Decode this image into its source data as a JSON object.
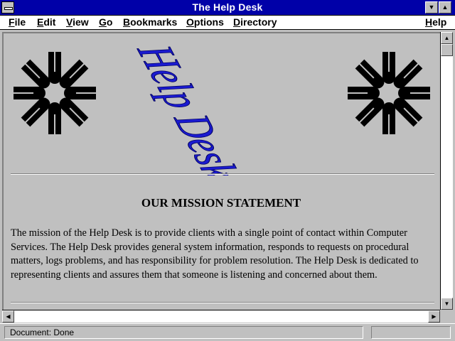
{
  "window": {
    "title": "The Help Desk",
    "minimize_glyph": "▼",
    "maximize_glyph": "▲"
  },
  "menubar": {
    "items": [
      "File",
      "Edit",
      "View",
      "Go",
      "Bookmarks",
      "Options",
      "Directory"
    ],
    "help": "Help"
  },
  "content": {
    "logo_wordart": "Help Desk",
    "wordart_color": "#1a1ad0",
    "logo_icon": "ring-emblem-icon",
    "mission_heading": "OUR MISSION STATEMENT",
    "mission_body": "The mission of the Help Desk is to provide clients with a single point of contact within Computer Services. The Help Desk provides general system information, responds to requests on procedural matters, logs problems, and has responsibility for problem resolution. The Help Desk is dedicated to representing clients and assures them that someone is listening and concerned about them."
  },
  "scrollbars": {
    "up": "▲",
    "down": "▼",
    "left": "◀",
    "right": "▶"
  },
  "status": {
    "text": "Document: Done"
  }
}
